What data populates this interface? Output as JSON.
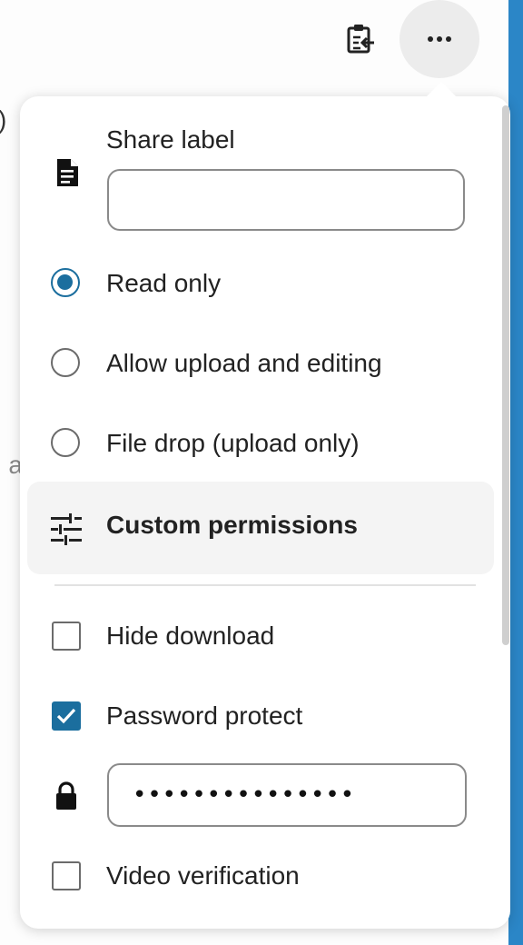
{
  "background": {
    "fragment_paren": ")",
    "fragment_text": "n a"
  },
  "toolbar": {
    "clipboard_icon": "clipboard-paste-icon",
    "more_icon": "more-horizontal-icon"
  },
  "popover": {
    "share_label": {
      "title": "Share label",
      "value": "",
      "icon": "document-icon"
    },
    "permissions": [
      {
        "label": "Read only",
        "checked": true
      },
      {
        "label": "Allow upload and editing",
        "checked": false
      },
      {
        "label": "File drop (upload only)",
        "checked": false
      }
    ],
    "custom_permissions": {
      "label": "Custom permissions",
      "icon": "tune-icon"
    },
    "options": {
      "hide_download": {
        "label": "Hide download",
        "checked": false
      },
      "password_protect": {
        "label": "Password protect",
        "checked": true
      },
      "password_value": "•••••••••••••••",
      "video_verification": {
        "label": "Video verification",
        "checked": false
      }
    }
  },
  "colors": {
    "accent": "#1b6e9e",
    "side_accent": "#2b86c7"
  }
}
